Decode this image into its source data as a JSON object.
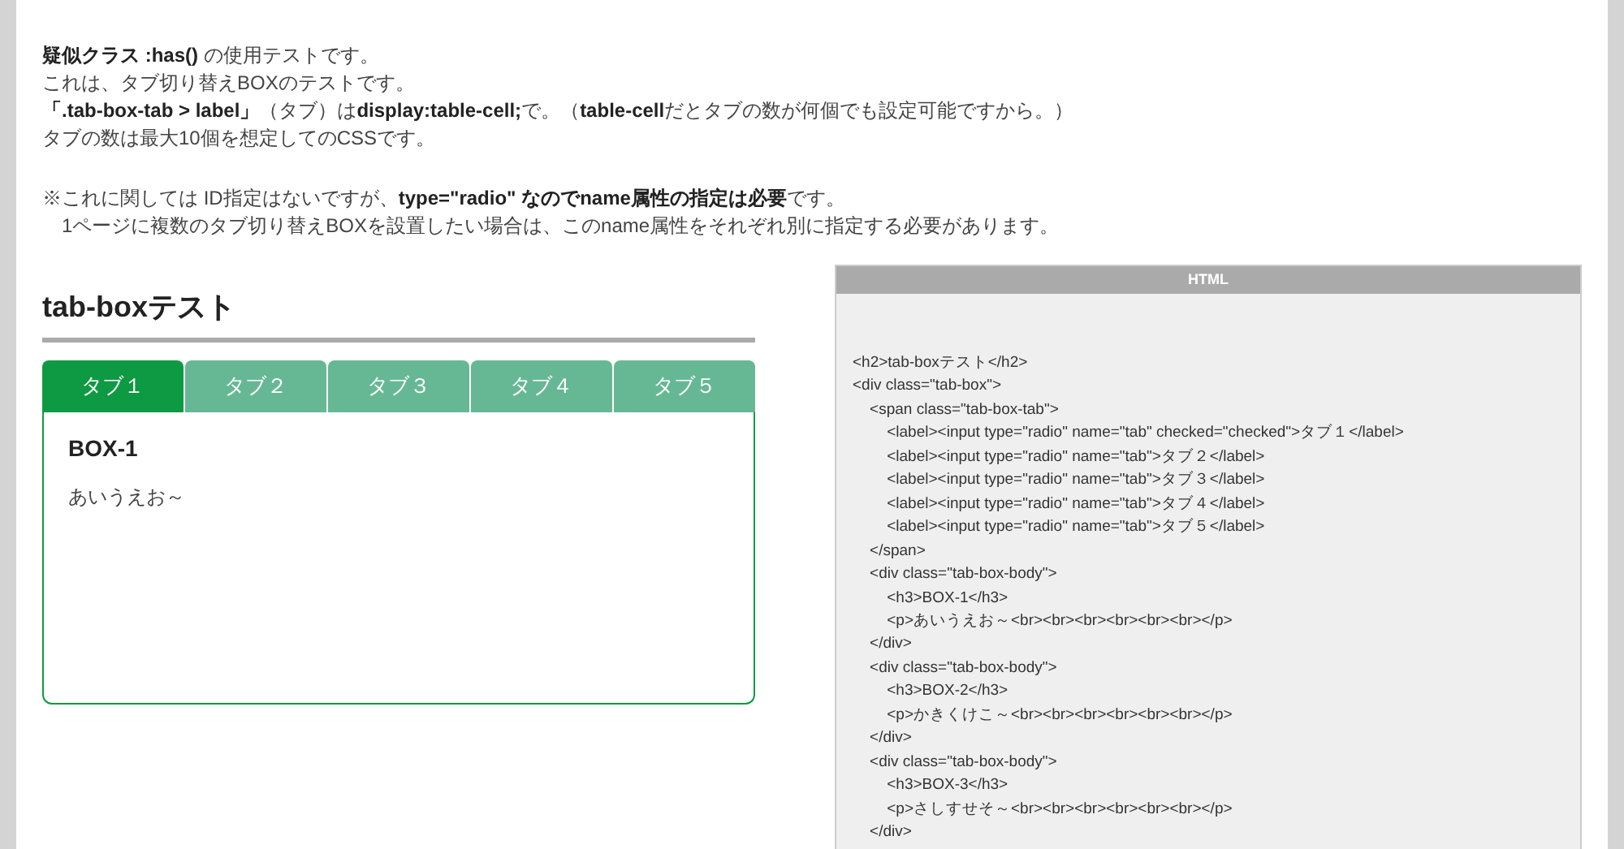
{
  "intro": [
    "**疑似クラス :has()** の使用テストです。",
    "これは、タブ切り替えBOXのテストです。",
    "**「.tab-box-tab > label」**（タブ）は**display:table-cell;**で。（**table-cell**だとタブの数が何個でも設定可能ですから。）",
    "タブの数は最大10個を想定してのCSSです。"
  ],
  "note": [
    "※これに関しては ID指定はないですが、**type=\"radio\" なのでname属性の指定は必要**です。",
    "　1ページに複数のタブ切り替えBOXを設置したい場合は、このname属性をそれぞれ別に指定する必要があります。"
  ],
  "demo": {
    "heading": "tab-boxテスト",
    "tabs": [
      {
        "label": "タブ１",
        "selected": true
      },
      {
        "label": "タブ２",
        "selected": false
      },
      {
        "label": "タブ３",
        "selected": false
      },
      {
        "label": "タブ４",
        "selected": false
      },
      {
        "label": "タブ５",
        "selected": false
      }
    ],
    "body_title": "BOX-1",
    "body_text": "あいうえお～"
  },
  "code_panel": {
    "title": "HTML",
    "lines": [
      "<h2>tab-boxテスト</h2>",
      "<div class=\"tab-box\">",
      "    <span class=\"tab-box-tab\">",
      "        <label><input type=\"radio\" name=\"tab\" checked=\"checked\">タブ１</label>",
      "        <label><input type=\"radio\" name=\"tab\">タブ２</label>",
      "        <label><input type=\"radio\" name=\"tab\">タブ３</label>",
      "        <label><input type=\"radio\" name=\"tab\">タブ４</label>",
      "        <label><input type=\"radio\" name=\"tab\">タブ５</label>",
      "    </span>",
      "    <div class=\"tab-box-body\">",
      "        <h3>BOX-1</h3>",
      "        <p>あいうえお～<br><br><br><br><br><br></p>",
      "    </div>",
      "    <div class=\"tab-box-body\">",
      "        <h3>BOX-2</h3>",
      "        <p>かきくけこ～<br><br><br><br><br><br></p>",
      "    </div>",
      "    <div class=\"tab-box-body\">",
      "        <h3>BOX-3</h3>",
      "        <p>さしすせそ～<br><br><br><br><br><br></p>",
      "    </div>"
    ]
  }
}
